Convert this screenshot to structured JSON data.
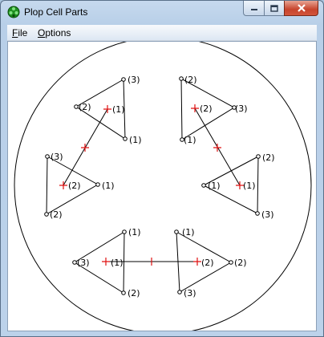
{
  "window": {
    "title": "Plop Cell Parts",
    "icon": "green-cell-icon",
    "buttons": [
      "minimize-icon",
      "maximize-icon",
      "close-icon"
    ]
  },
  "menu": {
    "file": {
      "accel": "F",
      "rest": "ile"
    },
    "options": {
      "accel": "O",
      "rest": "ptions"
    }
  },
  "canvas": {
    "colors": {
      "outline": "#000000",
      "marker": "#e01010",
      "background": "#ffffff"
    },
    "labels": {
      "ul_3": "(3)",
      "ul_2": "(2)",
      "ul_1a": "(1)",
      "ul_1b": "(1)",
      "ur_2": "(2)",
      "ur_2b": "(2)",
      "ur_3": "(3)",
      "ur_1": "(1)",
      "l_3": "(3)",
      "l_2": "(2)",
      "l_1": "(1)",
      "l_2b": "(2)",
      "r_1": "(1)",
      "r_1b": "(1)",
      "r_2": "(2)",
      "r_3": "(3)",
      "ll_1": "(1)",
      "ll_3": "(3)",
      "ll_1b": "(1)",
      "ll_2": "(2)",
      "lr_1": "(1)",
      "lr_2": "(2)",
      "lr_2b": "(2)",
      "lr_3": "(3)"
    }
  }
}
